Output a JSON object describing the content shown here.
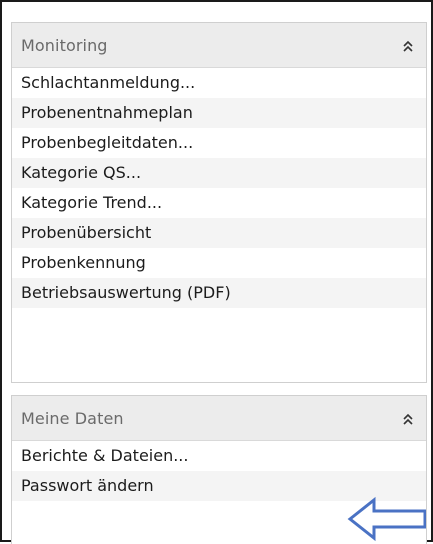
{
  "monitoring": {
    "title": "Monitoring",
    "collapse_icon": "double-chevron-up-icon",
    "items": [
      {
        "label": "Schlachtanmeldung..."
      },
      {
        "label": "Probenentnahmeplan"
      },
      {
        "label": "Probenbegleitdaten..."
      },
      {
        "label": "Kategorie QS..."
      },
      {
        "label": "Kategorie Trend..."
      },
      {
        "label": "Probenübersicht"
      },
      {
        "label": "Probenkennung"
      },
      {
        "label": "Betriebsauswertung (PDF)"
      }
    ]
  },
  "meine_daten": {
    "title": "Meine Daten",
    "collapse_icon": "double-chevron-up-icon",
    "items": [
      {
        "label": "Berichte & Dateien..."
      },
      {
        "label": "Passwort ändern"
      }
    ]
  },
  "annotation": {
    "icon": "arrow-left-icon",
    "color": "#4a72c4"
  }
}
